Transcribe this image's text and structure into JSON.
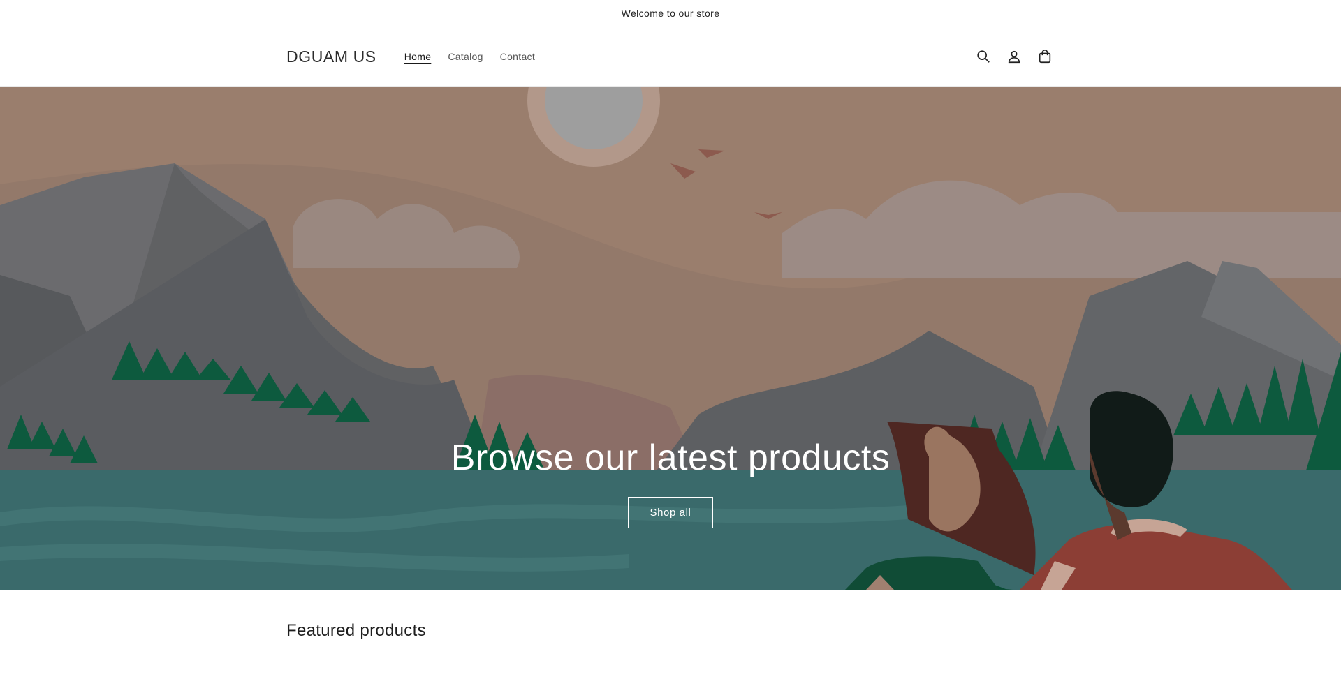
{
  "announcement": {
    "text": "Welcome to our store"
  },
  "header": {
    "logo": "DGUAM US",
    "nav": [
      {
        "label": "Home",
        "active": true
      },
      {
        "label": "Catalog",
        "active": false
      },
      {
        "label": "Contact",
        "active": false
      }
    ],
    "icons": [
      "search-icon",
      "account-icon",
      "cart-icon"
    ]
  },
  "hero": {
    "title": "Browse our latest products",
    "button_label": "Shop all"
  },
  "featured": {
    "heading": "Featured products"
  },
  "colors": {
    "sky": "#93796a",
    "water": "#3a6a6b",
    "mountain": "#5d5f62",
    "trees": "#0d5a3e",
    "text_on_hero": "#ffffff"
  }
}
